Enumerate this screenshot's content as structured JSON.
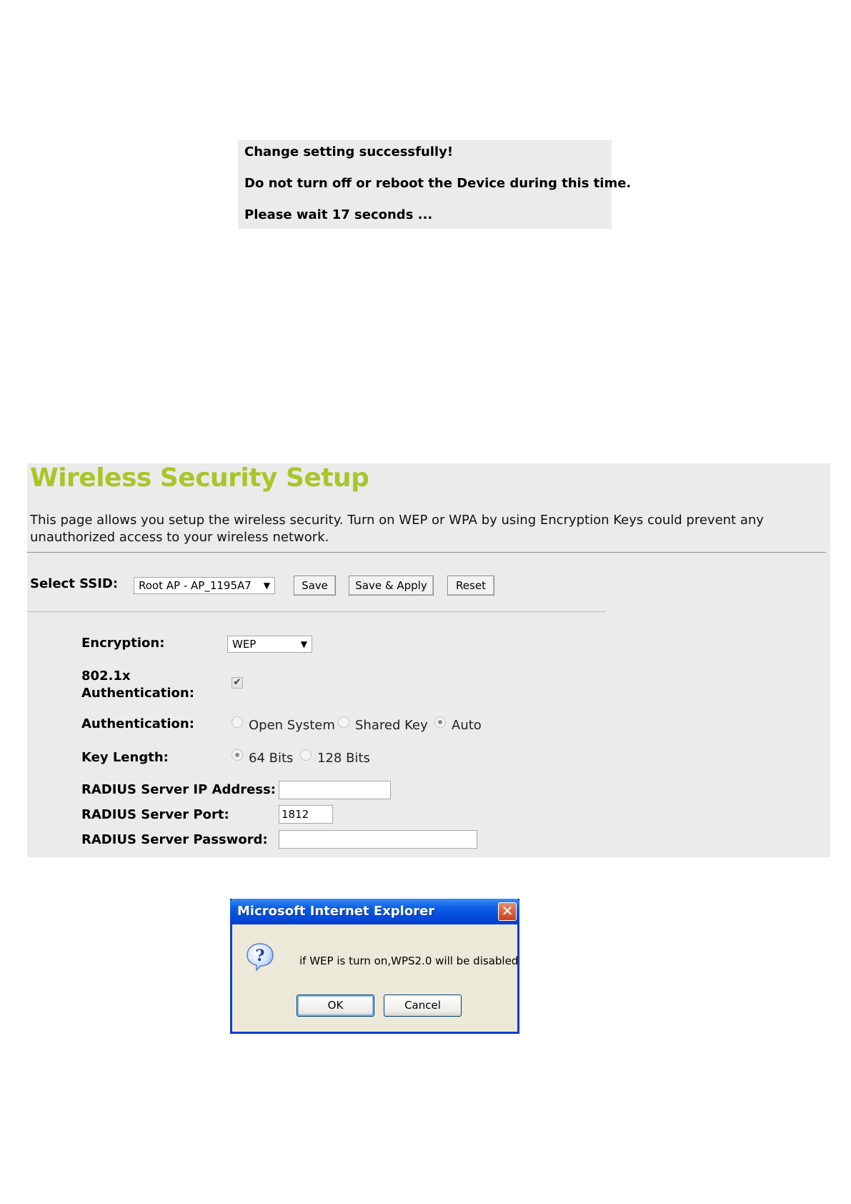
{
  "success_box": {
    "line1": "Change setting successfully!",
    "line2": "Do not turn off or reboot the Device during this time.",
    "line3": "Please wait 17 seconds ..."
  },
  "wireless": {
    "title": "Wireless Security Setup",
    "description": "This page allows you setup the wireless security. Turn on WEP or WPA by using Encryption Keys could prevent any unauthorized access to your wireless network.",
    "ssid_label": "Select SSID:",
    "ssid_value": "Root AP - AP_1195A7",
    "buttons": {
      "save": "Save",
      "save_apply": "Save & Apply",
      "reset": "Reset"
    },
    "encryption_label": "Encryption:",
    "encryption_value": "WEP",
    "auth8021x_label_line1": "802.1x",
    "auth8021x_label_line2": "Authentication:",
    "auth8021x_checked": true,
    "authentication_label": "Authentication:",
    "auth_options": [
      "Open System",
      "Shared Key",
      "Auto"
    ],
    "auth_selected": "Auto",
    "key_length_label": "Key Length:",
    "key_length_options": [
      "64 Bits",
      "128 Bits"
    ],
    "key_length_selected": "64 Bits",
    "radius_ip_label": "RADIUS Server IP Address:",
    "radius_ip_value": "",
    "radius_port_label": "RADIUS Server Port:",
    "radius_port_value": "1812",
    "radius_password_label": "RADIUS Server Password:",
    "radius_password_value": "",
    "accent_color": "#a8c62a"
  },
  "dialog": {
    "title": "Microsoft Internet Explorer",
    "message": "if WEP is turn on,WPS2.0 will be disabled",
    "ok": "OK",
    "cancel": "Cancel",
    "icon": "question-icon"
  }
}
